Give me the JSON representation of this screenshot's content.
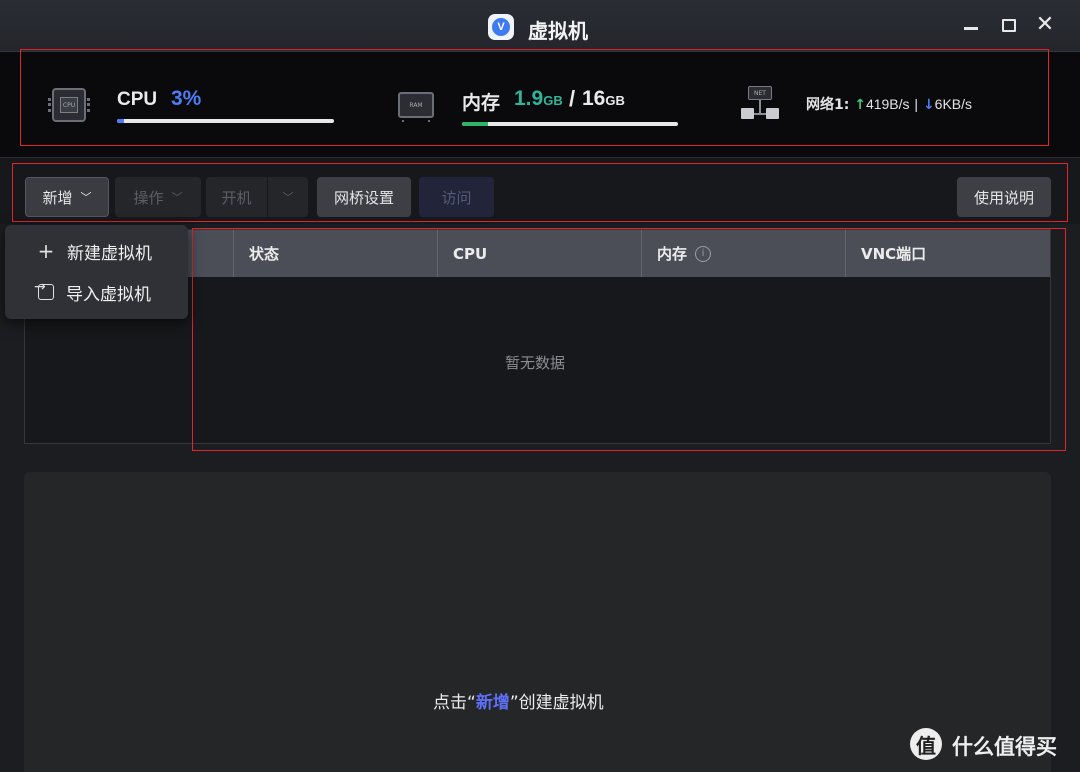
{
  "window": {
    "title": "虚拟机",
    "logo_letter": "V",
    "minimize_icon": "minimize-icon",
    "maximize_icon": "maximize-icon",
    "close_icon": "close-icon",
    "close_glyph": "✕"
  },
  "stats": {
    "cpu": {
      "icon": "cpu-chip-icon",
      "chip_text": "CPU",
      "label": "CPU",
      "value": "3%",
      "usage_fraction": 0.03,
      "color": "#4d7cf5"
    },
    "memory": {
      "icon": "ram-chip-icon",
      "chip_text": "RAM",
      "label": "内存",
      "used_value": "1.9",
      "used_unit": "GB",
      "separator": "/",
      "total_value": "16",
      "total_unit": "GB",
      "usage_fraction": 0.12,
      "color": "#2fb59a"
    },
    "network": {
      "icon": "network-icon",
      "chip_text": "NET",
      "label": "网络1:",
      "up_arrow": "↑",
      "up_value": "419B/s",
      "divider": "|",
      "down_arrow": "↓",
      "down_value": "6KB/s",
      "up_color": "#45c47a",
      "down_color": "#4d7cf5"
    }
  },
  "toolbar": {
    "new_label": "新增",
    "ops_label": "操作",
    "boot_label": "开机",
    "bridge_label": "网桥设置",
    "visit_label": "访问",
    "help_label": "使用说明",
    "chevron": "﹀"
  },
  "dropdown": {
    "items": [
      {
        "label": "新建虚拟机",
        "icon": "plus-icon",
        "glyph": "+"
      },
      {
        "label": "导入虚拟机",
        "icon": "import-icon"
      }
    ]
  },
  "table": {
    "columns": [
      "",
      "状态",
      "CPU",
      "内存",
      "VNC端口"
    ],
    "info_glyph": "i",
    "empty_text": "暂无数据"
  },
  "hint": {
    "prefix": "点击",
    "open_quote": "“",
    "link": "新增",
    "close_quote": "”",
    "suffix": "创建虚拟机"
  },
  "watermark": {
    "logo": "值",
    "text": "什么值得买"
  },
  "colors": {
    "accent": "#4d7cf5",
    "highlight_border": "#e0262a"
  }
}
